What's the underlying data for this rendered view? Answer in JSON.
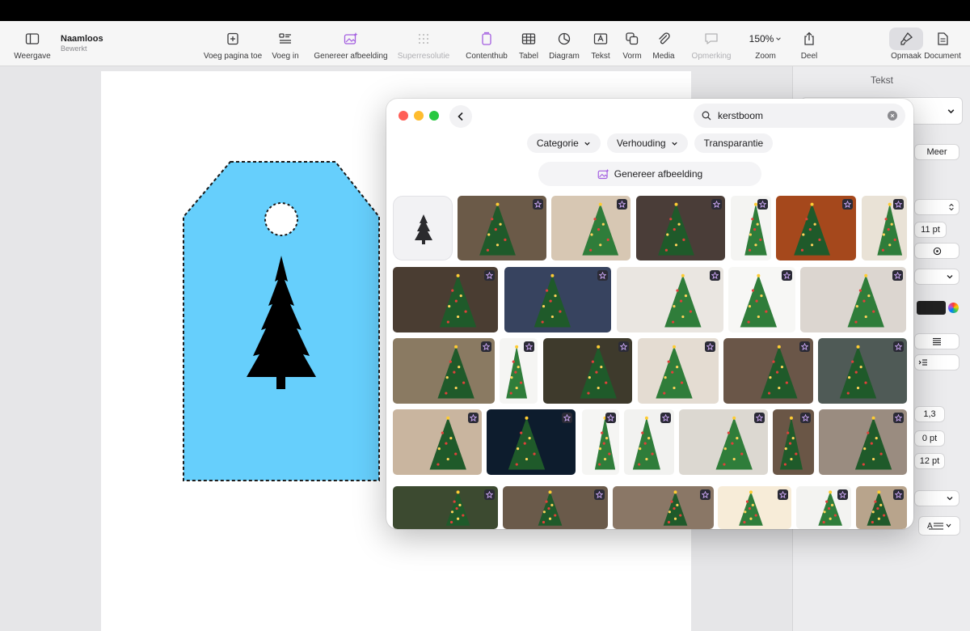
{
  "document": {
    "title": "Naamloos",
    "subtitle": "Bewerkt"
  },
  "toolbar": {
    "view_label": "Weergave",
    "add_page_label": "Voeg pagina toe",
    "insert_label": "Voeg in",
    "generate_image_label": "Genereer afbeelding",
    "super_resolution_label": "Superresolutie",
    "content_hub_label": "Contenthub",
    "table_label": "Tabel",
    "chart_label": "Diagram",
    "text_label": "Tekst",
    "shape_label": "Vorm",
    "media_label": "Media",
    "comment_label": "Opmerking",
    "zoom_value": "150%",
    "zoom_label": "Zoom",
    "share_label": "Deel",
    "format_label": "Opmaak",
    "document_label": "Document"
  },
  "sidebar": {
    "title": "Tekst",
    "more_label": "Meer",
    "font_size": "11 pt",
    "line_spacing": "1,3",
    "space_before": "0 pt",
    "space_after": "12 pt"
  },
  "popup": {
    "search_value": "kerstboom",
    "filters": [
      "Categorie",
      "Verhouding",
      "Transparantie"
    ],
    "generate_label": "Genereer afbeelding"
  },
  "colors": {
    "tag_fill": "#66cffc",
    "accent_purple": "#a35ee0",
    "traffic_close": "#ff5f57",
    "traffic_min": "#febc2e",
    "traffic_max": "#28c840"
  }
}
